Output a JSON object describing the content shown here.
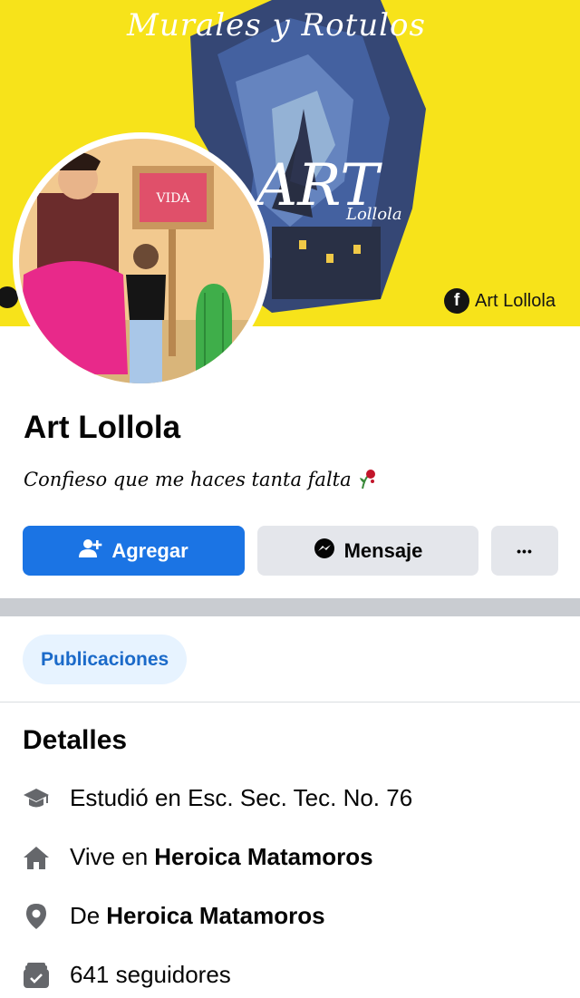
{
  "cover": {
    "script_text": "Murales y Rotulos",
    "art_title": "ART",
    "art_subtitle": "Lollola",
    "fb_badge_letter": "f",
    "fb_badge_text": "Art Lollola",
    "background": "#f7e31a"
  },
  "profile": {
    "name": "Art Lollola",
    "bio": "Confieso que me haces tanta falta",
    "bio_emoji": "wilted-rose-icon"
  },
  "actions": {
    "add_label": "Agregar",
    "add_icon": "add-friend-icon",
    "message_label": "Mensaje",
    "message_icon": "messenger-icon",
    "more_label": "•••"
  },
  "tabs": {
    "posts_label": "Publicaciones"
  },
  "details": {
    "title": "Detalles",
    "items": [
      {
        "icon": "graduation-cap-icon",
        "prefix": "Estudió en Esc. Sec. Tec. No. 76",
        "bold": ""
      },
      {
        "icon": "home-icon",
        "prefix": "Vive en",
        "bold": "Heroica Matamoros"
      },
      {
        "icon": "location-pin-icon",
        "prefix": "De",
        "bold": "Heroica Matamoros"
      },
      {
        "icon": "followers-icon",
        "prefix": "641 seguidores",
        "bold": ""
      }
    ]
  },
  "colors": {
    "primary_button": "#1b74e4",
    "secondary_button": "#e4e6eb",
    "tab_background": "#e7f3ff",
    "tab_text": "#1b6ac9",
    "icon_gray": "#65676b"
  }
}
